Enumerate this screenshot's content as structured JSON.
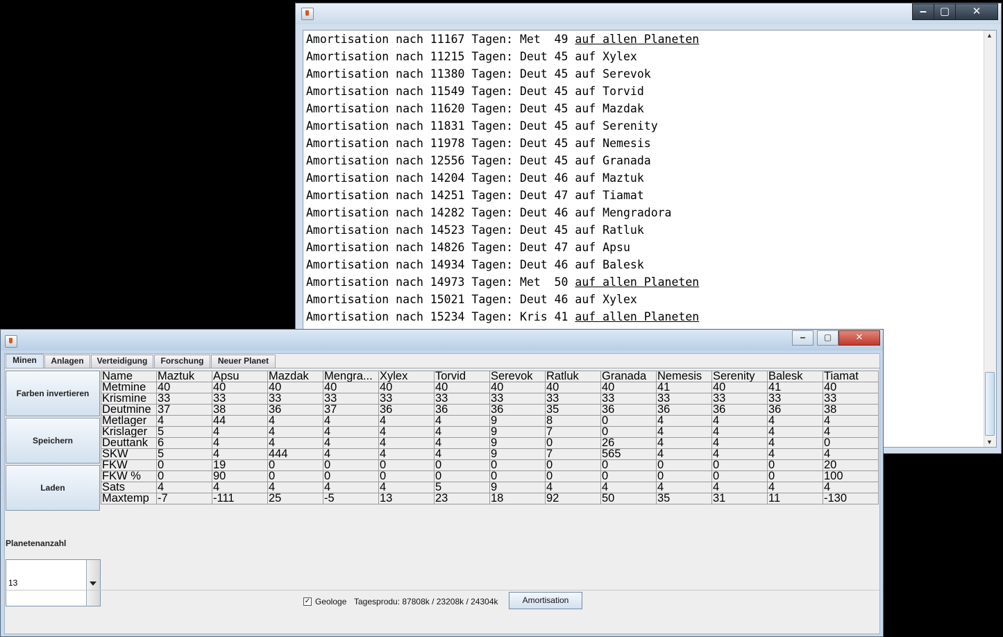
{
  "log_window": {
    "lines": [
      {
        "prefix": "Amortisation nach 11167 Tagen: Met  49 ",
        "target": "auf allen Planeten",
        "underline": true
      },
      {
        "prefix": "Amortisation nach 11215 Tagen: Deut 45 ",
        "target": "auf Xylex",
        "underline": false
      },
      {
        "prefix": "Amortisation nach 11380 Tagen: Deut 45 ",
        "target": "auf Serevok",
        "underline": false
      },
      {
        "prefix": "Amortisation nach 11549 Tagen: Deut 45 ",
        "target": "auf Torvid",
        "underline": false
      },
      {
        "prefix": "Amortisation nach 11620 Tagen: Deut 45 ",
        "target": "auf Mazdak",
        "underline": false
      },
      {
        "prefix": "Amortisation nach 11831 Tagen: Deut 45 ",
        "target": "auf Serenity",
        "underline": false
      },
      {
        "prefix": "Amortisation nach 11978 Tagen: Deut 45 ",
        "target": "auf Nemesis",
        "underline": false
      },
      {
        "prefix": "Amortisation nach 12556 Tagen: Deut 45 ",
        "target": "auf Granada",
        "underline": false
      },
      {
        "prefix": "Amortisation nach 14204 Tagen: Deut 46 ",
        "target": "auf Maztuk",
        "underline": false
      },
      {
        "prefix": "Amortisation nach 14251 Tagen: Deut 47 ",
        "target": "auf Tiamat",
        "underline": false
      },
      {
        "prefix": "Amortisation nach 14282 Tagen: Deut 46 ",
        "target": "auf Mengradora",
        "underline": false
      },
      {
        "prefix": "Amortisation nach 14523 Tagen: Deut 45 ",
        "target": "auf Ratluk",
        "underline": false
      },
      {
        "prefix": "Amortisation nach 14826 Tagen: Deut 47 ",
        "target": "auf Apsu",
        "underline": false
      },
      {
        "prefix": "Amortisation nach 14934 Tagen: Deut 46 ",
        "target": "auf Balesk",
        "underline": false
      },
      {
        "prefix": "Amortisation nach 14973 Tagen: Met  50 ",
        "target": "auf allen Planeten",
        "underline": true
      },
      {
        "prefix": "Amortisation nach 15021 Tagen: Deut 46 ",
        "target": "auf Xylex",
        "underline": false
      },
      {
        "prefix": "Amortisation nach 15234 Tagen: Kris 41 ",
        "target": "auf allen Planeten",
        "underline": true
      }
    ],
    "controls": {
      "minimize": "‒",
      "maximize": "▢",
      "close": "✕"
    }
  },
  "main_window": {
    "tabs": [
      "Minen",
      "Anlagen",
      "Verteidigung",
      "Forschung",
      "Neuer Planet"
    ],
    "active_tab": "Minen",
    "buttons": {
      "invert": "Farben invertieren",
      "save": "Speichern",
      "load": "Laden"
    },
    "planet_count_label": "Planetenanzahl",
    "planet_count_value": "13",
    "table": {
      "headers": [
        "Name",
        "Maztuk",
        "Apsu",
        "Mazdak",
        "Mengra...",
        "Xylex",
        "Torvid",
        "Serevok",
        "Ratluk",
        "Granada",
        "Nemesis",
        "Serenity",
        "Balesk",
        "Tiamat"
      ],
      "rows": [
        [
          "Metmine",
          "40",
          "40",
          "40",
          "40",
          "40",
          "40",
          "40",
          "40",
          "40",
          "41",
          "40",
          "41",
          "40"
        ],
        [
          "Krismine",
          "33",
          "33",
          "33",
          "33",
          "33",
          "33",
          "33",
          "33",
          "33",
          "33",
          "33",
          "33",
          "33"
        ],
        [
          "Deutmine",
          "37",
          "38",
          "36",
          "37",
          "36",
          "36",
          "36",
          "35",
          "36",
          "36",
          "36",
          "36",
          "38"
        ],
        [
          "Metlager",
          "4",
          "44",
          "4",
          "4",
          "4",
          "4",
          "9",
          "8",
          "0",
          "4",
          "4",
          "4",
          "4"
        ],
        [
          "Krislager",
          "5",
          "4",
          "4",
          "4",
          "4",
          "4",
          "9",
          "7",
          "0",
          "4",
          "4",
          "4",
          "4"
        ],
        [
          "Deuttank",
          "6",
          "4",
          "4",
          "4",
          "4",
          "4",
          "9",
          "0",
          "26",
          "4",
          "4",
          "4",
          "0"
        ],
        [
          "SKW",
          "5",
          "4",
          "444",
          "4",
          "4",
          "4",
          "9",
          "7",
          "565",
          "4",
          "4",
          "4",
          "4"
        ],
        [
          "FKW",
          "0",
          "19",
          "0",
          "0",
          "0",
          "0",
          "0",
          "0",
          "0",
          "0",
          "0",
          "0",
          "20"
        ],
        [
          "FKW %",
          "0",
          "90",
          "0",
          "0",
          "0",
          "0",
          "0",
          "0",
          "0",
          "0",
          "0",
          "0",
          "100"
        ],
        [
          "Sats",
          "4",
          "4",
          "4",
          "4",
          "4",
          "5",
          "9",
          "4",
          "4",
          "4",
          "4",
          "4",
          "4"
        ],
        [
          "Maxtemp",
          "-7",
          "-111",
          "25",
          "-5",
          "13",
          "23",
          "18",
          "92",
          "50",
          "35",
          "31",
          "11",
          "-130"
        ]
      ]
    },
    "status": {
      "checkbox_label": "Geologe",
      "checkbox_checked": true,
      "production_text": "Tagesprodu: 87808k / 23208k / 24304k",
      "amortisation_button": "Amortisation"
    },
    "controls": {
      "minimize": "‒",
      "maximize": "▢",
      "close": "✕"
    }
  },
  "colors": {
    "close_red": "#c8423a",
    "title_blue": "#c5d8ec"
  }
}
